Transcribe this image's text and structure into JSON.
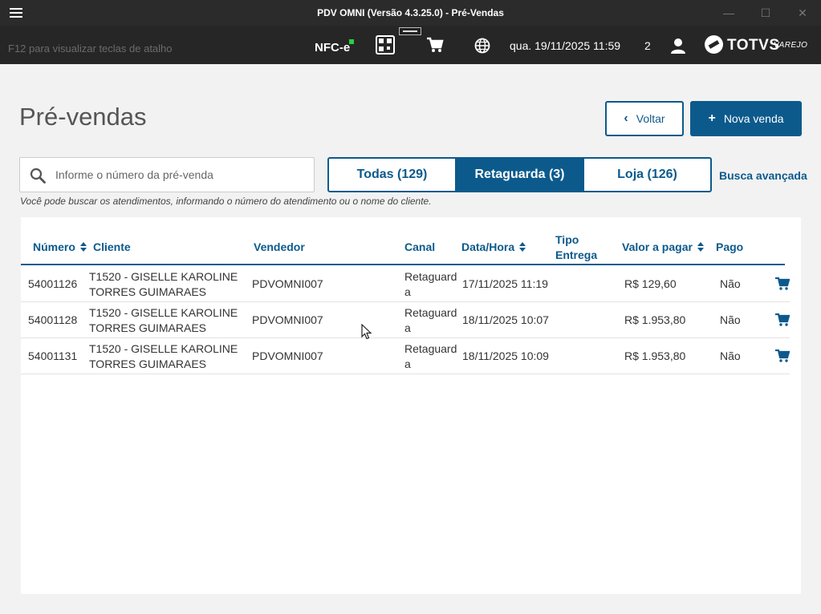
{
  "window": {
    "title": "PDV OMNI (Versão 4.3.25.0) - Pré-Vendas"
  },
  "statusbar": {
    "hint": "F12 para visualizar teclas de atalho",
    "nfce": "NFC-e",
    "datetime": "qua. 19/11/2025 11:59",
    "count": "2",
    "brand": "TOTVS",
    "brand_sub": "VAREJO"
  },
  "page": {
    "title": "Pré-vendas",
    "back_label": "Voltar",
    "new_label": "Nova venda"
  },
  "search": {
    "placeholder": "Informe o número da pré-venda",
    "helper": "Você pode buscar os atendimentos, informando o número do atendimento ou o nome do cliente."
  },
  "filters": {
    "all": "Todas (129)",
    "backoffice": "Retaguarda (3)",
    "store": "Loja (126)",
    "active": "Retaguarda (3)",
    "advanced": "Busca avançada"
  },
  "table": {
    "headers": {
      "numero": "Número",
      "cliente": "Cliente",
      "vendedor": "Vendedor",
      "canal": "Canal",
      "datahora": "Data/Hora",
      "tipo_1": "Tipo",
      "tipo_2": "Entrega",
      "valor": "Valor a pagar",
      "pago": "Pago"
    },
    "rows": [
      {
        "numero": "54001126",
        "cliente_1": "T1520 - GISELLE KAROLINE",
        "cliente_2": "TORRES GUIMARAES",
        "vendedor": "PDVOMNI007",
        "canal_1": "Retaguard",
        "canal_2": "a",
        "datahora": "17/11/2025 11:19",
        "valor": "R$ 129,60",
        "pago": "Não"
      },
      {
        "numero": "54001128",
        "cliente_1": "T1520 - GISELLE KAROLINE",
        "cliente_2": "TORRES GUIMARAES",
        "vendedor": "PDVOMNI007",
        "canal_1": "Retaguard",
        "canal_2": "a",
        "datahora": "18/11/2025 10:07",
        "valor": "R$ 1.953,80",
        "pago": "Não"
      },
      {
        "numero": "54001131",
        "cliente_1": "T1520 - GISELLE KAROLINE",
        "cliente_2": "TORRES GUIMARAES",
        "vendedor": "PDVOMNI007",
        "canal_1": "Retaguard",
        "canal_2": "a",
        "datahora": "18/11/2025 10:09",
        "valor": "R$ 1.953,80",
        "pago": "Não"
      }
    ]
  },
  "colors": {
    "primary": "#0c5a8c",
    "titlebar": "#2b2b2b",
    "statusbar": "#262626",
    "background": "#f2f2f2"
  },
  "icons": [
    "hamburger-menu-icon",
    "qr-code-icon",
    "printer-icon",
    "cart-icon",
    "globe-icon",
    "user-icon",
    "search-icon",
    "chevron-left-icon",
    "plus-icon",
    "sort-icon",
    "cart-icon"
  ]
}
